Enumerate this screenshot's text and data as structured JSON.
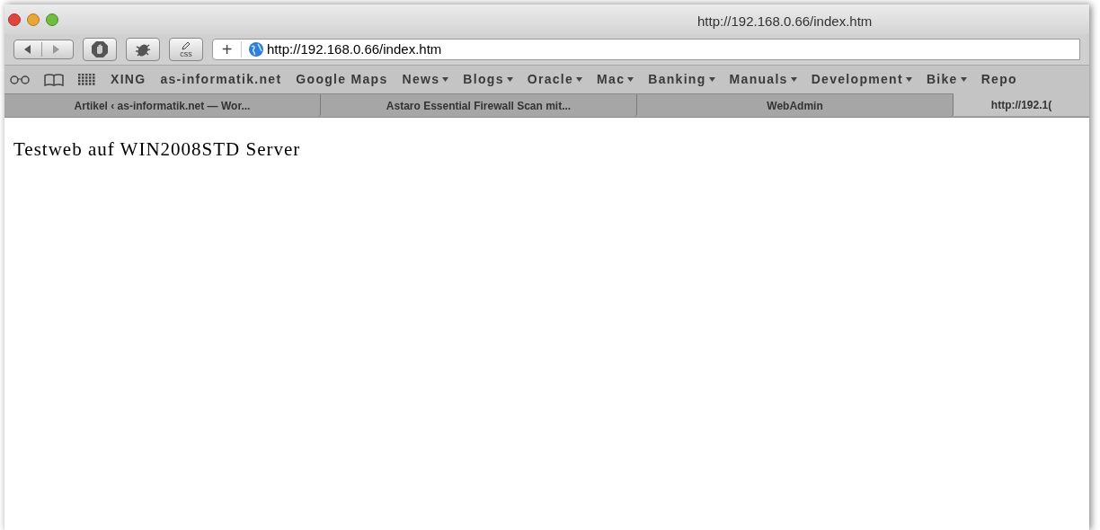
{
  "window": {
    "title": "http://192.168.0.66/index.htm"
  },
  "toolbar": {
    "address": "http://192.168.0.66/index.htm",
    "add_button": "+",
    "css_label": "css"
  },
  "bookmarks": [
    {
      "label": "XING",
      "menu": false
    },
    {
      "label": "as-informatik.net",
      "menu": false
    },
    {
      "label": "Google Maps",
      "menu": false
    },
    {
      "label": "News",
      "menu": true
    },
    {
      "label": "Blogs",
      "menu": true
    },
    {
      "label": "Oracle",
      "menu": true
    },
    {
      "label": "Mac",
      "menu": true
    },
    {
      "label": "Banking",
      "menu": true
    },
    {
      "label": "Manuals",
      "menu": true
    },
    {
      "label": "Development",
      "menu": true
    },
    {
      "label": "Bike",
      "menu": true
    },
    {
      "label": "Repo",
      "menu": false
    }
  ],
  "tabs": [
    {
      "label": "Artikel ‹ as-informatik.net — Wor...",
      "selected": false
    },
    {
      "label": "Astaro Essential Firewall Scan mit...",
      "selected": false
    },
    {
      "label": "WebAdmin",
      "selected": false
    },
    {
      "label": "http://192.1(",
      "selected": true
    }
  ],
  "page": {
    "text": "Testweb auf WIN2008STD Server"
  }
}
